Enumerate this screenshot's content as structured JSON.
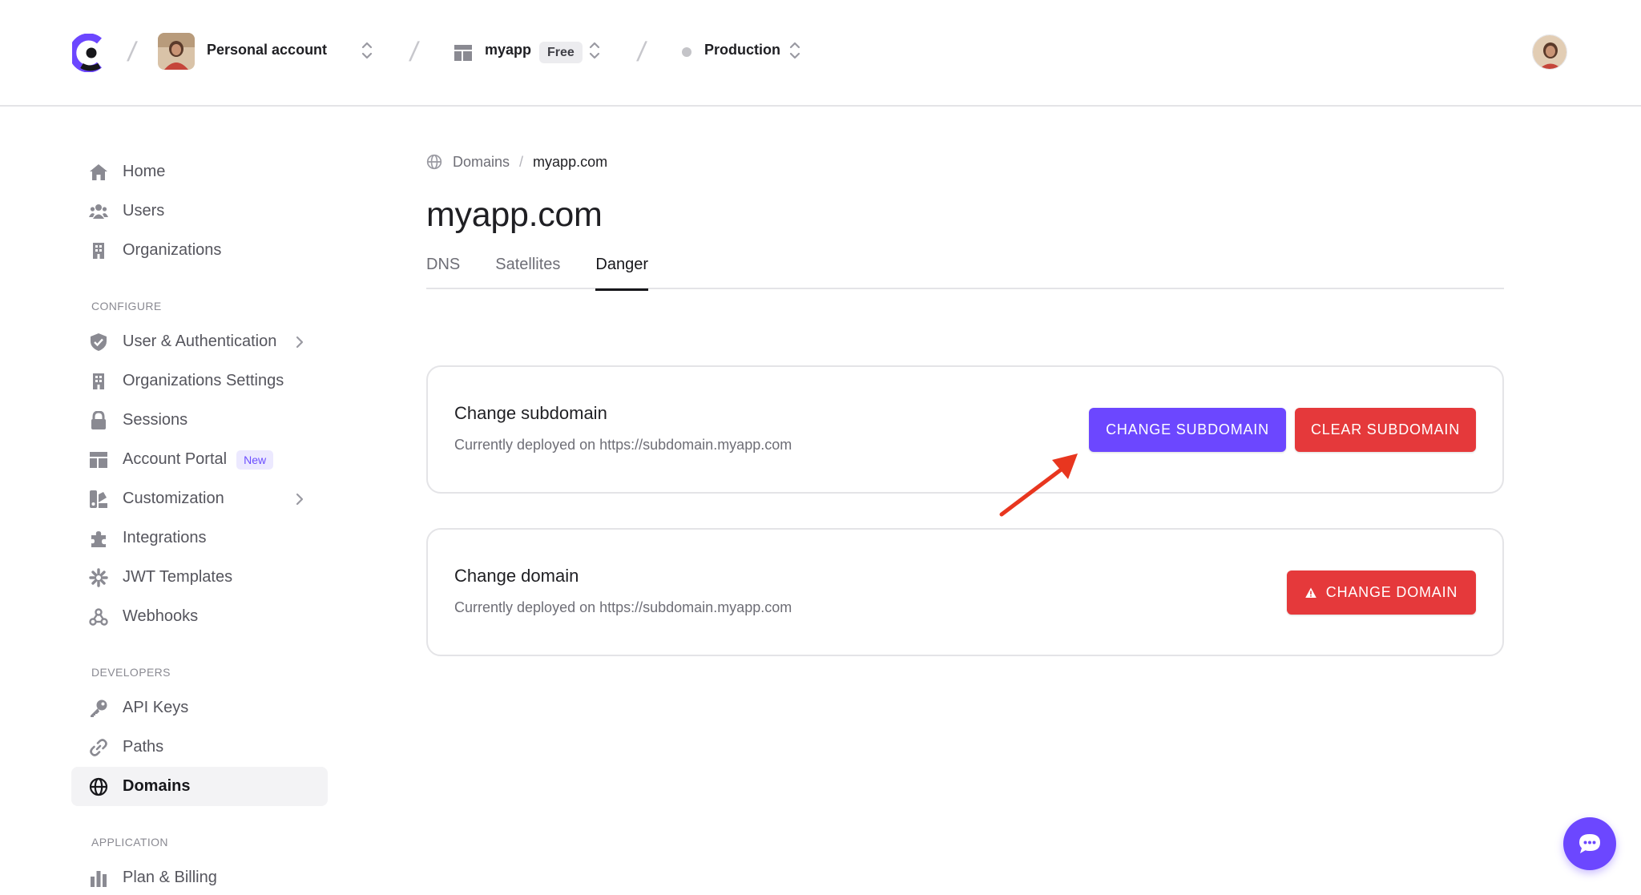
{
  "header": {
    "account_label": "Personal account",
    "app_label": "myapp",
    "app_plan_badge": "Free",
    "environment_label": "Production"
  },
  "sidebar": {
    "items_main": [
      {
        "label": "Home",
        "icon": "home-icon"
      },
      {
        "label": "Users",
        "icon": "users-icon"
      },
      {
        "label": "Organizations",
        "icon": "building-icon"
      }
    ],
    "configure_label": "CONFIGURE",
    "items_configure": [
      {
        "label": "User & Authentication",
        "icon": "shield-icon",
        "has_submenu": true
      },
      {
        "label": "Organizations Settings",
        "icon": "building-icon"
      },
      {
        "label": "Sessions",
        "icon": "lock-icon"
      },
      {
        "label": "Account Portal",
        "icon": "layout-icon",
        "badge": "New"
      },
      {
        "label": "Customization",
        "icon": "paint-icon",
        "has_submenu": true
      },
      {
        "label": "Integrations",
        "icon": "puzzle-icon"
      },
      {
        "label": "JWT Templates",
        "icon": "asterisk-icon"
      },
      {
        "label": "Webhooks",
        "icon": "webhook-icon"
      }
    ],
    "developers_label": "DEVELOPERS",
    "items_developers": [
      {
        "label": "API Keys",
        "icon": "key-icon"
      },
      {
        "label": "Paths",
        "icon": "link-icon"
      },
      {
        "label": "Domains",
        "icon": "globe-icon",
        "active": true
      }
    ],
    "application_label": "APPLICATION",
    "items_application": [
      {
        "label": "Plan & Billing",
        "icon": "chart-icon"
      }
    ]
  },
  "main": {
    "breadcrumb": {
      "parent": "Domains",
      "separator": "/",
      "current": "myapp.com"
    },
    "title": "myapp.com",
    "tabs": [
      {
        "label": "DNS"
      },
      {
        "label": "Satellites"
      },
      {
        "label": "Danger",
        "active": true
      }
    ],
    "cards": [
      {
        "title": "Change subdomain",
        "subtitle": "Currently deployed on https://subdomain.myapp.com",
        "primary_button": "CHANGE SUBDOMAIN",
        "danger_button": "CLEAR SUBDOMAIN"
      },
      {
        "title": "Change domain",
        "subtitle": "Currently deployed on https://subdomain.myapp.com",
        "danger_button": "CHANGE DOMAIN"
      }
    ]
  },
  "colors": {
    "primary": "#6c47ff",
    "danger": "#e5393b",
    "annotation_arrow": "#e8361f"
  }
}
